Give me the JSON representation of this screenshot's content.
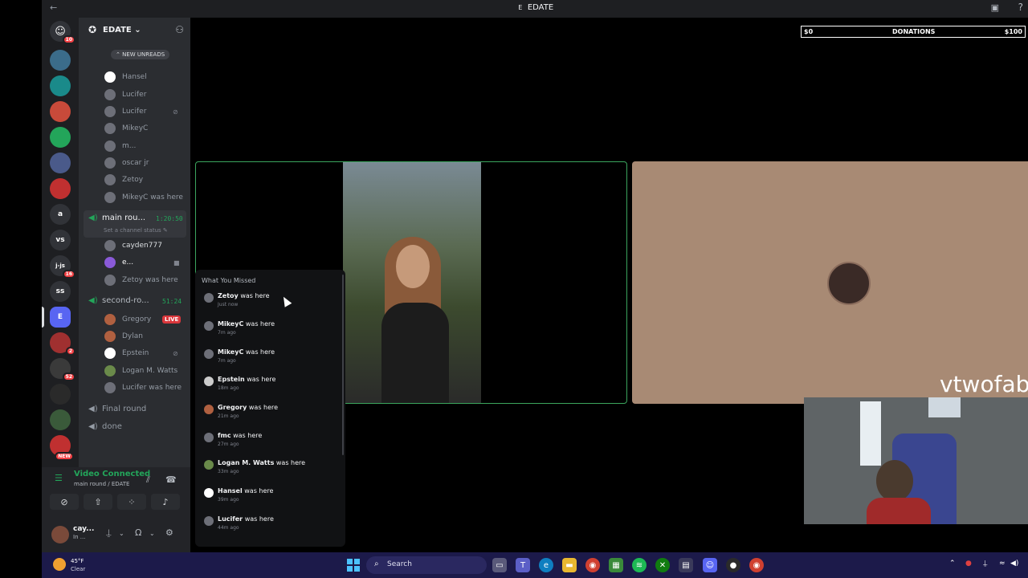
{
  "titlebar": {
    "back": "←",
    "forward": "→",
    "title": "EDATE",
    "icon_letter": "E"
  },
  "servers": [
    {
      "label": "",
      "badge": "10",
      "color": "#5865f2"
    },
    {
      "label": "",
      "badge": "",
      "color": "#3b6c8a"
    },
    {
      "label": "",
      "badge": "",
      "color": "#1a8a8a"
    },
    {
      "label": "",
      "badge": "",
      "color": "#c84a3a"
    },
    {
      "label": "",
      "badge": "",
      "color": "#23a55a"
    },
    {
      "label": "",
      "badge": "",
      "color": "#4a5a8a"
    },
    {
      "label": "",
      "badge": "",
      "color": "#c03030"
    },
    {
      "label": "a",
      "badge": "",
      "color": "#313338"
    },
    {
      "label": "vs",
      "badge": "",
      "color": "#313338"
    },
    {
      "label": "j-js",
      "badge": "16",
      "color": "#313338"
    },
    {
      "label": "ss",
      "badge": "",
      "color": "#313338"
    },
    {
      "label": "E",
      "badge": "",
      "color": "#5865f2"
    },
    {
      "label": "",
      "badge": "2",
      "color": "#a03030"
    },
    {
      "label": "",
      "badge": "52",
      "color": "#3a3a3a"
    },
    {
      "label": "",
      "badge": "",
      "color": "#2a2a2a"
    },
    {
      "label": "",
      "badge": "",
      "color": "#3a5a3a"
    },
    {
      "label": "",
      "badge": "NEW",
      "color": "#c03030"
    }
  ],
  "guild": {
    "name": "EDATE",
    "new_unreads": "NEW UNREADS"
  },
  "channel_list": {
    "top_users": [
      "Hansel",
      "Lucifer",
      "Lucifer",
      "MikeyC",
      "m...",
      "oscar jr",
      "Zetoy"
    ],
    "top_was": {
      "name": "MikeyC",
      "suffix": "was here"
    },
    "main_round": {
      "name": "main rou...",
      "timer": "1:20:50",
      "status": "Set a channel status"
    },
    "main_users": [
      "cayden777",
      "e..."
    ],
    "main_was": {
      "name": "Zetoy",
      "suffix": "was here"
    },
    "second_round": {
      "name": "second-ro...",
      "timer": "51:24"
    },
    "second_users": [
      "Gregory",
      "Dylan",
      "Epstein",
      "Logan M. Watts"
    ],
    "live_label": "LIVE",
    "second_was": {
      "name": "Lucifer",
      "suffix": "was here"
    },
    "final_round": "Final round",
    "done": "done"
  },
  "voice_panel": {
    "status": "Video Connected",
    "sub": "main round / EDATE",
    "user_name": "cay...",
    "user_sub": "In ..."
  },
  "donations": {
    "left": "$0",
    "center": "DONATIONS",
    "right": "$100"
  },
  "stage": {
    "overlay_name": "vtwofab"
  },
  "what_you_missed": {
    "header": "What You Missed",
    "items": [
      {
        "name": "Zetoy",
        "suffix": "was here",
        "time": "Just now"
      },
      {
        "name": "MikeyC",
        "suffix": "was here",
        "time": "7m ago"
      },
      {
        "name": "MikeyC",
        "suffix": "was here",
        "time": "7m ago"
      },
      {
        "name": "Epstein",
        "suffix": "was here",
        "time": "18m ago"
      },
      {
        "name": "Gregory",
        "suffix": "was here",
        "time": "21m ago"
      },
      {
        "name": "fmc",
        "suffix": "was here",
        "time": "27m ago"
      },
      {
        "name": "Logan M. Watts",
        "suffix": "was here",
        "time": "33m ago"
      },
      {
        "name": "Hansel",
        "suffix": "was here",
        "time": "39m ago"
      },
      {
        "name": "Lucifer",
        "suffix": "was here",
        "time": "44m ago"
      }
    ]
  },
  "taskbar": {
    "temperature": "45°F",
    "condition": "Clear",
    "search_label": "Search"
  }
}
